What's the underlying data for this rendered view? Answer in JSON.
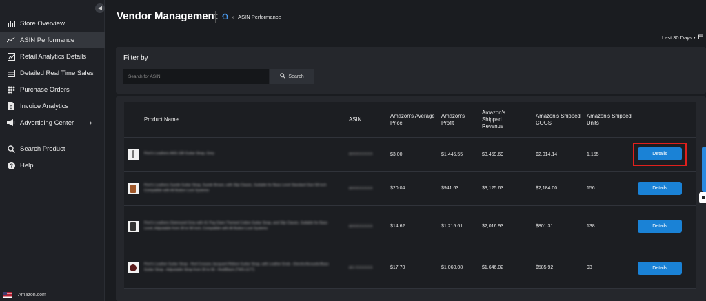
{
  "sidebar": {
    "collapse_icon": "chevron-left-icon",
    "items": [
      {
        "label": "Store Overview",
        "icon": "bar-chart-icon"
      },
      {
        "label": "ASIN Performance",
        "icon": "trend-line-icon"
      },
      {
        "label": "Retail Analytics Details",
        "icon": "analytics-icon"
      },
      {
        "label": "Detailed Real Time Sales",
        "icon": "sales-table-icon"
      },
      {
        "label": "Purchase Orders",
        "icon": "grid-icon"
      },
      {
        "label": "Invoice Analytics",
        "icon": "invoice-icon"
      },
      {
        "label": "Advertising Center",
        "icon": "megaphone-icon"
      },
      {
        "label": "Search Product",
        "icon": "search-icon"
      },
      {
        "label": "Help",
        "icon": "help-icon"
      }
    ],
    "active_index": 1,
    "footer_marketplace": "Amazon.com"
  },
  "header": {
    "title": "Vendor Management",
    "breadcrumb_home_icon": "home-icon",
    "breadcrumb_separator": "»",
    "breadcrumb_current": "ASIN Performance"
  },
  "date_range": {
    "label": "Last 30 Days",
    "icon": "calendar-icon"
  },
  "filter": {
    "title": "Filter by",
    "search_placeholder": "Search for ASIN",
    "search_button": "Search"
  },
  "table": {
    "columns": [
      "Product Name",
      "ASIN",
      "Amazon's Average Price",
      "Amazon's Profit",
      "Amazon's Shipped Revenue",
      "Amazon's Shipped COGS",
      "Amazon's Shipped Units"
    ],
    "rows": [
      {
        "product_name": "Perri's Leathers ANS-180 Guitar Strap, Grey",
        "asin": "B00XXXXXX",
        "avg_price": "$3.00",
        "profit": "$1,445.55",
        "revenue": "$3,459.69",
        "cogs": "$2,014.14",
        "units": "1,155",
        "action": "Details",
        "thumb_color": "#777777"
      },
      {
        "product_name": "Perri's Leathers Suede Guitar Strap, Suede Brown, with Slip Classic, Suitable for Bass Level Standard Size 58 inch Compatible with All Button Lock Systems",
        "asin": "B00XXXXXX",
        "avg_price": "$20.04",
        "profit": "$941.63",
        "revenue": "$3,125.63",
        "cogs": "$2,184.00",
        "units": "156",
        "action": "Details",
        "thumb_color": "#a0582a"
      },
      {
        "product_name": "Perri's Leathers Distressed Grey with 41 Peg Glam-Themed Cotton Guitar Strap, and Slip Classic, Suitable for Bass Level, Adjustable from 39 to 58 inch, Compatible with All Button Lock Systems",
        "asin": "B00XXXXXX",
        "avg_price": "$14.62",
        "profit": "$1,215.61",
        "revenue": "$2,016.93",
        "cogs": "$801.31",
        "units": "138",
        "action": "Details",
        "thumb_color": "#333333"
      },
      {
        "product_name": "Perri's Leather Guitar Strap - Red Crosses Jacquard Ribbon Guitar Strap, with Leather Ends - Electric/Acoustic/Bass Guitar Strap - Adjustable Strap from 39 to 58 - Red/Black (TWS-1177)",
        "asin": "B07XXXXXX",
        "avg_price": "$17.70",
        "profit": "$1,060.08",
        "revenue": "$1,646.02",
        "cogs": "$585.92",
        "units": "93",
        "action": "Details",
        "thumb_color": "#5a1a1a"
      }
    ]
  }
}
